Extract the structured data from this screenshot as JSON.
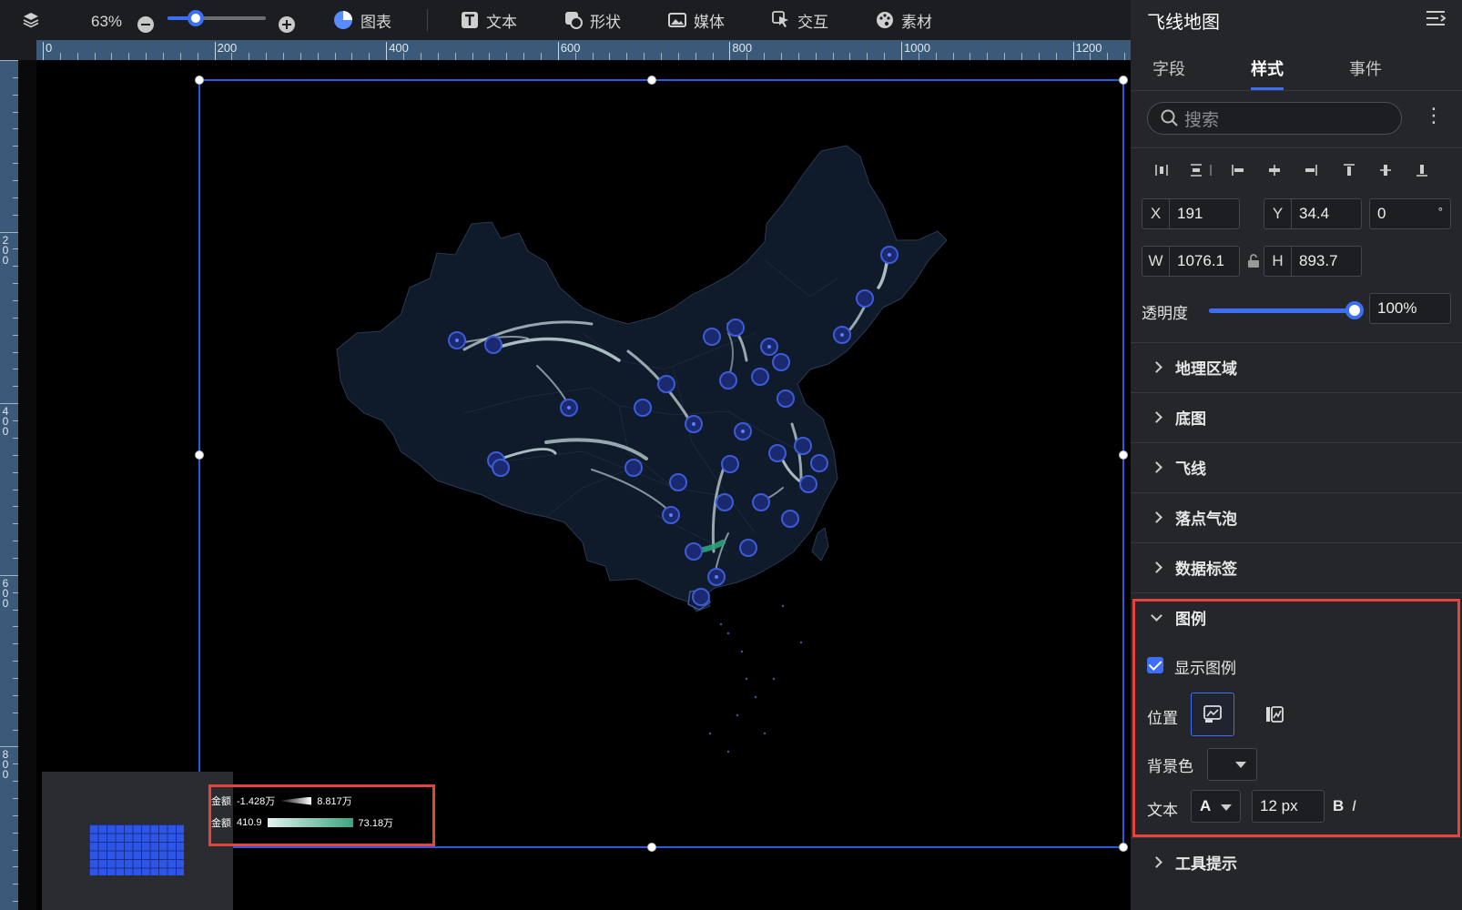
{
  "toolbar": {
    "zoom_value": "63%",
    "items": [
      {
        "label": "图表",
        "icon": "chart-pie-icon"
      },
      {
        "label": "文本",
        "icon": "text-icon"
      },
      {
        "label": "形状",
        "icon": "shape-icon"
      },
      {
        "label": "媒体",
        "icon": "image-icon"
      },
      {
        "label": "交互",
        "icon": "cursor-icon"
      },
      {
        "label": "素材",
        "icon": "palette-icon"
      }
    ]
  },
  "ruler": {
    "h_labels": [
      "0",
      "200",
      "400",
      "600",
      "800",
      "1000",
      "1200"
    ],
    "v_labels": [
      "200",
      "400",
      "600",
      "800"
    ]
  },
  "legend": {
    "rows": [
      {
        "label": "金额",
        "min": "-1.428万",
        "max": "8.817万"
      },
      {
        "label": "金额",
        "min": "410.9",
        "max": "73.18万"
      }
    ]
  },
  "panel": {
    "title": "飞线地图",
    "tabs": [
      "字段",
      "样式",
      "事件"
    ],
    "active_tab": "样式",
    "search_placeholder": "搜索",
    "fields": {
      "x_label": "X",
      "x_value": "191",
      "y_label": "Y",
      "y_value": "34.4",
      "rotation_value": "0",
      "rotation_unit": "°",
      "w_label": "W",
      "w_value": "1076.1",
      "h_label": "H",
      "h_value": "893.7"
    },
    "opacity_label": "透明度",
    "opacity_value": "100%",
    "sections": [
      "地理区域",
      "底图",
      "飞线",
      "落点气泡",
      "数据标签"
    ],
    "legend_section": {
      "title": "图例",
      "show_legend_label": "显示图例",
      "show_legend_checked": true,
      "position_label": "位置",
      "bg_color_label": "背景色",
      "text_label": "文本",
      "font_glyph": "A",
      "font_size": "12 px",
      "bold": "B",
      "italic": "I"
    },
    "tooltip_section": "工具提示"
  },
  "colors": {
    "accent": "#3d6ff5",
    "highlight_box": "#e4443c",
    "map_fill": "#0f1a2a",
    "flyline": "#cfe6e6"
  }
}
